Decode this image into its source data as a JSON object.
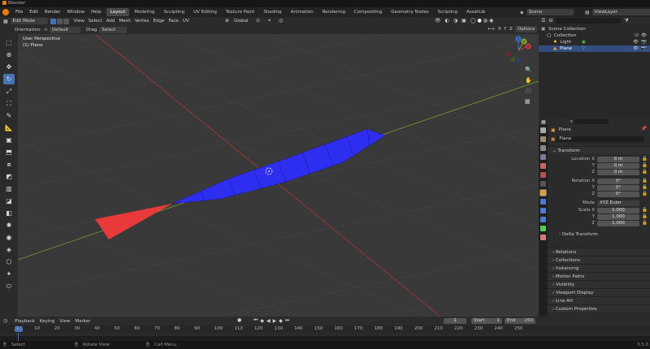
{
  "window": {
    "title": "Blender"
  },
  "menu": {
    "items": [
      "File",
      "Edit",
      "Render",
      "Window",
      "Help"
    ]
  },
  "workspaces": {
    "tabs": [
      "Layout",
      "Modeling",
      "Sculpting",
      "UV Editing",
      "Texture Paint",
      "Shading",
      "Animation",
      "Rendering",
      "Compositing",
      "Geometry Nodes",
      "Scripting",
      "AssetLib"
    ],
    "active": "Layout"
  },
  "topright": {
    "scene": "Scene",
    "view_layer": "ViewLayer"
  },
  "viewport_header": {
    "mode": "Edit Mode",
    "menus": [
      "View",
      "Select",
      "Add",
      "Mesh",
      "Vertex",
      "Edge",
      "Face",
      "UV"
    ],
    "transform": "Global"
  },
  "tool_header": {
    "orientation_label": "Orientation:",
    "orientation_value": "Default",
    "drag_label": "Drag",
    "drag_value": "Select Box",
    "options": "Options"
  },
  "viewport": {
    "view_name": "User Perspective",
    "object_name": "(1) Plane"
  },
  "gizmo": {
    "x": "X",
    "y": "Y",
    "z": "Z"
  },
  "outliner": {
    "rows": [
      "Scene Collection",
      "Collection",
      "Light",
      "Plane"
    ]
  },
  "properties": {
    "object_name": "Plane",
    "data_name": "Plane",
    "transform_title": "Transform",
    "location_label": "Location X",
    "location": [
      "0 m",
      "0 m",
      "0 m"
    ],
    "rotation_label": "Rotation X",
    "rotation": [
      "0°",
      "0°",
      "0°"
    ],
    "mode_label": "Mode",
    "mode_value": "XYZ Euler",
    "scale_label": "Scale X",
    "scale": [
      "1.000",
      "1.000",
      "1.000"
    ],
    "axis_labels": [
      "Y",
      "Z"
    ],
    "delta": "Delta Transform",
    "panels": [
      "Relations",
      "Collections",
      "Instancing",
      "Motion Paths",
      "Visibility",
      "Viewport Display",
      "Line Art",
      "Custom Properties"
    ]
  },
  "timeline": {
    "menus": [
      "Playback",
      "Keying",
      "View",
      "Marker"
    ],
    "current_frame": "1",
    "start_label": "Start",
    "start": "1",
    "end_label": "End",
    "end": "250",
    "ticks": [
      "1",
      "10",
      "20",
      "30",
      "40",
      "50",
      "60",
      "70",
      "80",
      "90",
      "100",
      "110",
      "120",
      "130",
      "140",
      "150",
      "160",
      "170",
      "180",
      "190",
      "200",
      "210",
      "220",
      "230",
      "240",
      "250"
    ]
  },
  "statusbar": {
    "select": "Select",
    "rotate": "Rotate View",
    "menu": "Call Menu",
    "version": "3.5.0"
  },
  "colors": {
    "accent": "#4772b3",
    "orange": "#e87d0d",
    "mesh_blue": "#2e2ef0",
    "mesh_red": "#e83a3a",
    "axis_red": "#b03434",
    "axis_green": "#7c9a2a"
  }
}
